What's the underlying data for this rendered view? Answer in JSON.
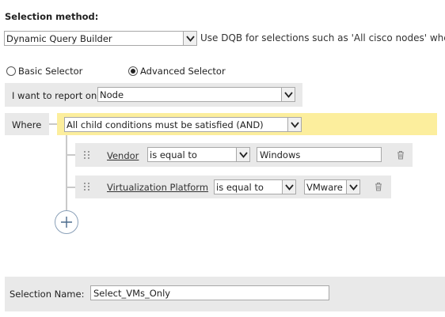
{
  "selection_method": {
    "title": "Selection method:",
    "dropdown_value": "Dynamic Query Builder",
    "hint": "Use DQB for selections such as 'All cisco nodes' whe"
  },
  "selector_mode": {
    "basic_label": "Basic Selector",
    "advanced_label": "Advanced Selector",
    "selected": "advanced"
  },
  "report_on": {
    "label": "I want to report on",
    "value": "Node"
  },
  "where": {
    "label": "Where",
    "group_condition": "All child conditions must be satisfied (AND)"
  },
  "conditions": [
    {
      "field": "Vendor",
      "operator": "is equal to",
      "value": "Windows"
    },
    {
      "field": "Virtualization Platform",
      "operator": "is equal to",
      "value": "VMware"
    }
  ],
  "selection_name": {
    "label": "Selection Name:",
    "value": "Select_VMs_Only"
  },
  "icons": {
    "dropdown": "chevron-down-icon",
    "delete": "trash-icon",
    "drag": "drag-handle-icon",
    "add": "plus-icon"
  },
  "colors": {
    "where_highlight": "#fcee9d",
    "panel_gray": "#e9e9e9"
  }
}
